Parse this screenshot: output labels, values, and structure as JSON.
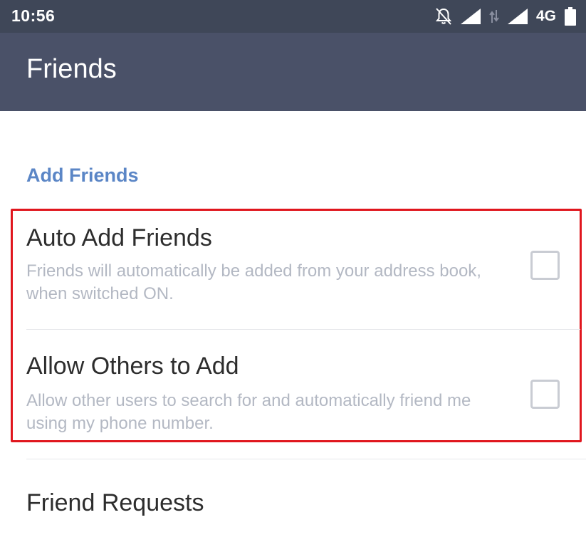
{
  "status_bar": {
    "time": "10:56",
    "network": "4G",
    "icons": [
      "bell-off-icon",
      "signal-icon",
      "data-arrows-icon",
      "signal-icon",
      "battery-icon"
    ]
  },
  "app_bar": {
    "title": "Friends",
    "background_color": "#4a5168"
  },
  "section": {
    "header": "Add Friends",
    "header_color": "#5b86c6"
  },
  "settings": [
    {
      "title": "Auto Add Friends",
      "description": "Friends will automatically be added from your address book, when switched ON.",
      "checked": false
    },
    {
      "title": "Allow Others to Add",
      "description": "Allow other users to search for and automatically friend me using my phone number.",
      "checked": false
    }
  ],
  "friend_requests": {
    "title": "Friend Requests"
  },
  "highlight_color": "#e0161e"
}
